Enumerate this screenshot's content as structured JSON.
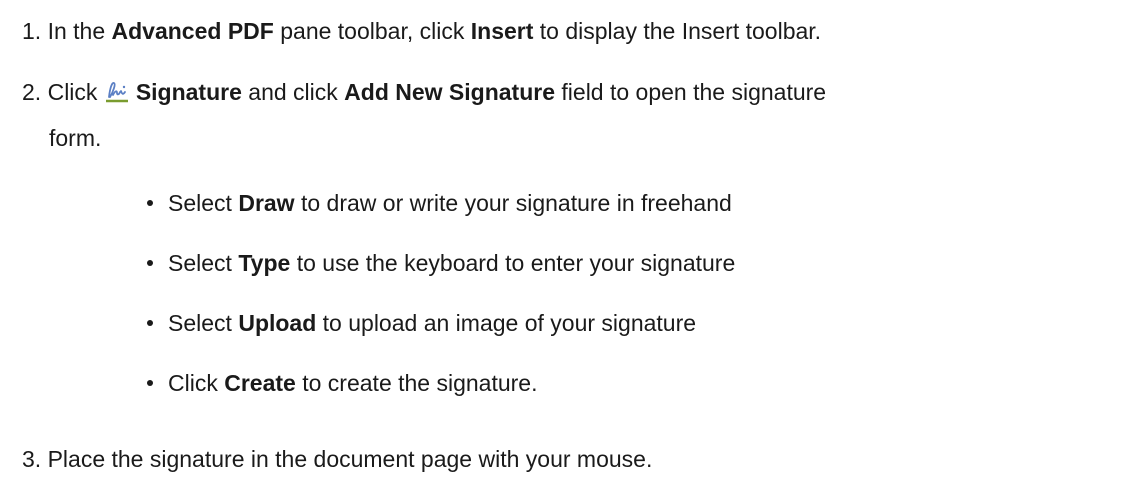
{
  "steps": [
    {
      "number": "1.",
      "parts": [
        "In the ",
        "Advanced PDF",
        " pane toolbar, click ",
        "Insert",
        " to display the Insert toolbar."
      ]
    },
    {
      "number": "2.",
      "icon": "signature-icon",
      "parts": [
        "Signature",
        " and click ",
        "Add New Signature",
        " field to open the signature"
      ],
      "prefix": "Click ",
      "continuation": "form."
    },
    {
      "number": "3.",
      "parts": [
        "Place the signature in the document page with your mouse."
      ]
    }
  ],
  "bullets": [
    {
      "parts": [
        "Select ",
        "Draw",
        " to draw or write your signature in freehand"
      ]
    },
    {
      "parts": [
        "Select ",
        "Type",
        " to use the keyboard to enter your signature"
      ]
    },
    {
      "parts": [
        "Select ",
        "Upload",
        " to upload an image of your signature"
      ]
    },
    {
      "parts": [
        "Click ",
        "Create",
        " to create the signature."
      ]
    }
  ],
  "colors": {
    "text": "#1a1a1a",
    "icon_blue": "#5b7fc4",
    "icon_underline": "#7a9c2f"
  }
}
